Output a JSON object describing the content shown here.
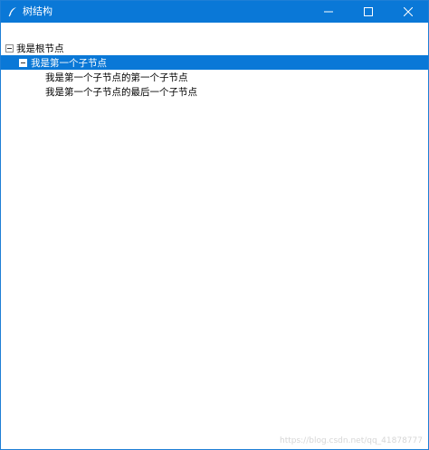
{
  "window": {
    "title": "树结构",
    "title_bar_color": "#0a78d7",
    "icons": {
      "app": "feather-icon",
      "minimize": "minimize-icon",
      "maximize": "maximize-icon",
      "close": "close-icon"
    }
  },
  "tree": {
    "selection_color": "#0a78d7",
    "root": {
      "label": "我是根节点",
      "expanded": true
    },
    "child": {
      "label": "我是第一个子节点",
      "expanded": true,
      "selected": true
    },
    "grandchildren": [
      {
        "label": "我是第一个子节点的第一个子节点"
      },
      {
        "label": "我是第一个子节点的最后一个子节点"
      }
    ]
  },
  "watermark": {
    "text": "https://blog.csdn.net/qq_41878777"
  }
}
